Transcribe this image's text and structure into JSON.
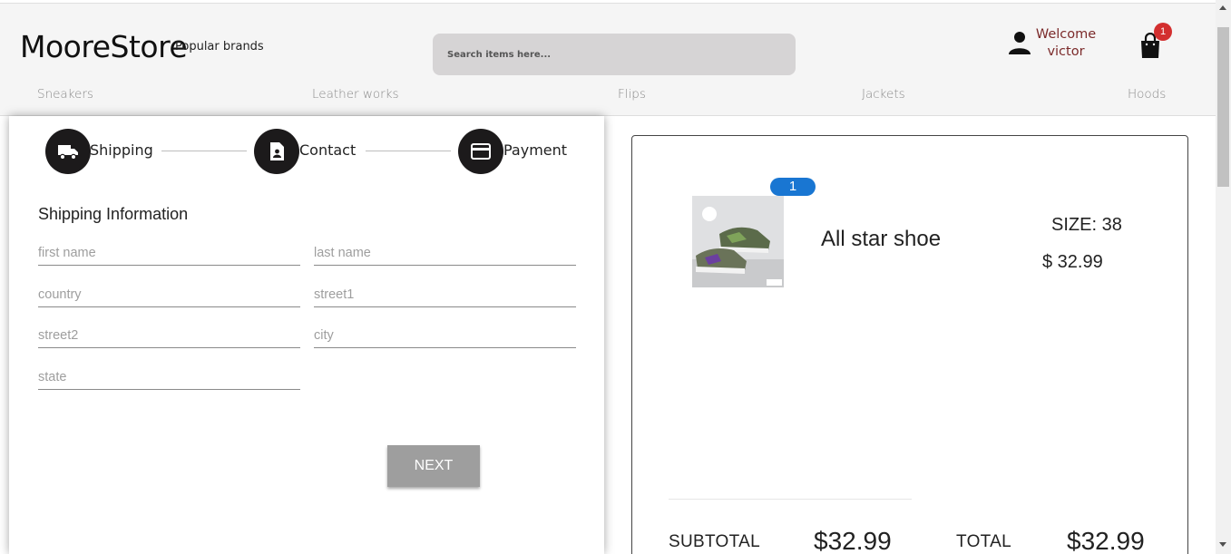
{
  "header": {
    "logo": "MooreStore",
    "popular_brands": "Popular brands",
    "search_placeholder": "Search items here...",
    "welcome_line1": "Welcome",
    "welcome_line2": "victor",
    "cart_count": "1"
  },
  "nav": {
    "items": [
      "Sneakers",
      "Leather works",
      "Flips",
      "Jackets",
      "Hoods"
    ]
  },
  "steps": [
    {
      "label": "Shipping",
      "icon": "truck-icon"
    },
    {
      "label": "Contact",
      "icon": "contact-icon"
    },
    {
      "label": "Payment",
      "icon": "credit-card-icon"
    }
  ],
  "form": {
    "title": "Shipping Information",
    "fields": {
      "first_name": {
        "placeholder": "first name",
        "value": ""
      },
      "last_name": {
        "placeholder": "last name",
        "value": ""
      },
      "country": {
        "placeholder": "country",
        "value": ""
      },
      "street1": {
        "placeholder": "street1",
        "value": ""
      },
      "street2": {
        "placeholder": "street2",
        "value": ""
      },
      "city": {
        "placeholder": "city",
        "value": ""
      },
      "state": {
        "placeholder": "state",
        "value": ""
      }
    },
    "next_label": "NEXT"
  },
  "cart": {
    "item": {
      "quantity": "1",
      "name": "All star shoe",
      "size": "SIZE: 38",
      "price": "$ 32.99"
    },
    "subtotal_label": "SUBTOTAL",
    "subtotal_value": "$32.99",
    "total_label": "TOTAL",
    "total_value": "$32.99"
  },
  "colors": {
    "header_bg": "#f5f5f5",
    "step_circle": "#1c1a1b",
    "quantity_badge": "#1976d2",
    "cart_badge": "#d32f2f",
    "welcome_text": "#7b2a2a",
    "next_button": "#9e9e9e"
  }
}
